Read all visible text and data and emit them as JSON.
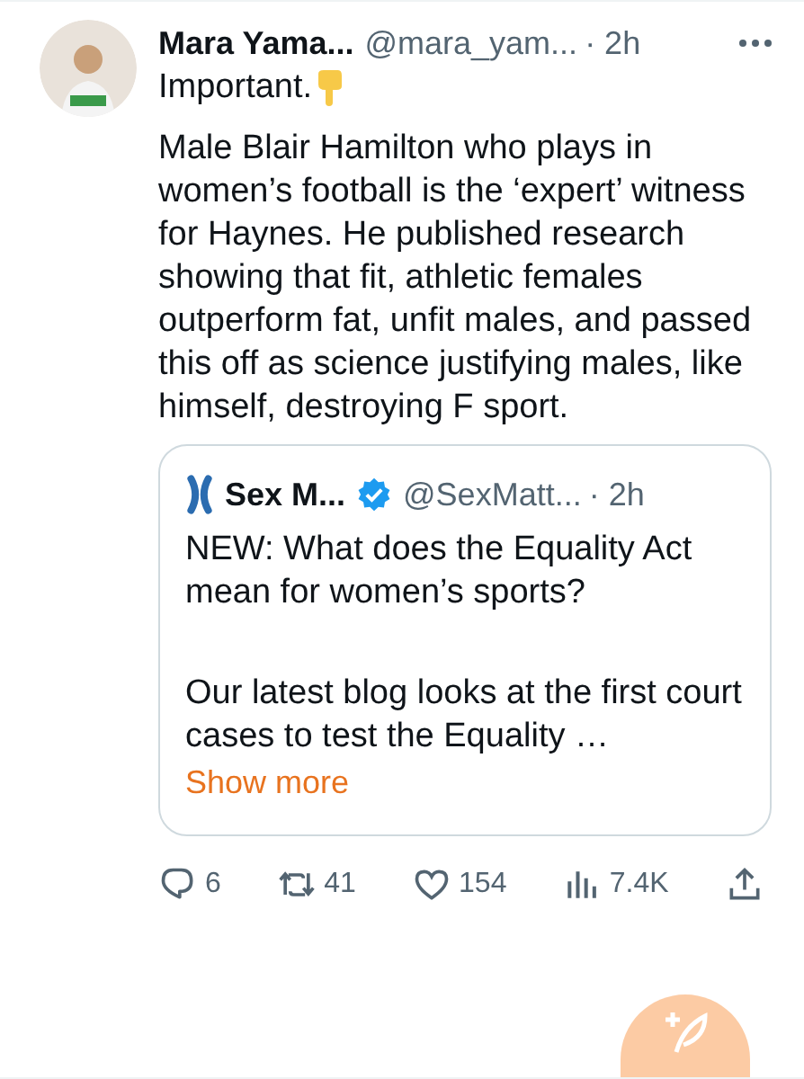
{
  "tweet": {
    "author": {
      "name": "Mara Yama...",
      "handle": "@mara_yam...",
      "time": "· 2h"
    },
    "text": [
      "Important.",
      "Male Blair Hamilton who plays in women’s football is the ‘expert’ witness for Haynes. He published research showing that fit, athletic females outperform fat, unfit males, and passed this off as science justifying males, like himself, destroying F sport."
    ],
    "quote": {
      "author": {
        "name": "Sex M...",
        "verified": true,
        "handle": "@SexMatt...",
        "time": "· 2h"
      },
      "text": [
        "NEW: What does the Equality Act mean for women’s sports?",
        "Our latest blog looks at the first court cases to test the Equality …"
      ],
      "show_more": "Show more"
    },
    "actions": [
      {
        "kind": "reply",
        "count": "6"
      },
      {
        "kind": "repost",
        "count": "41"
      },
      {
        "kind": "like",
        "count": "154"
      },
      {
        "kind": "views",
        "count": "7.4K"
      },
      {
        "kind": "share"
      }
    ]
  }
}
